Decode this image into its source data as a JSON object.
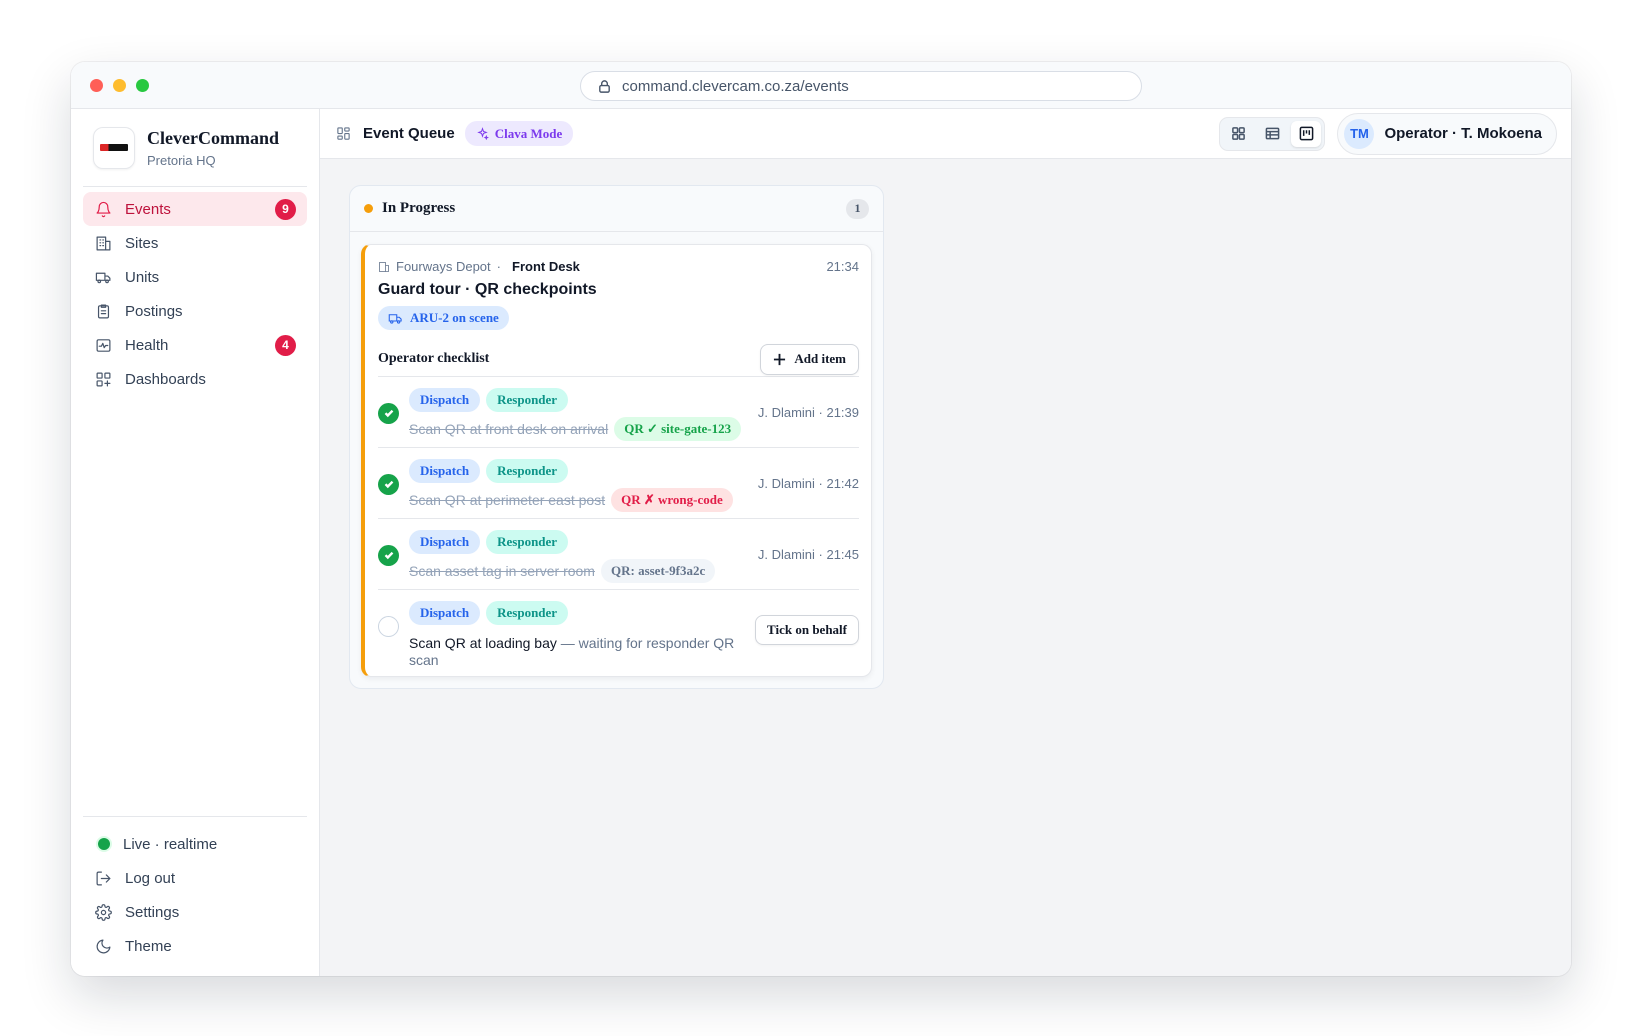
{
  "browser": {
    "url": "command.clevercam.co.za/events"
  },
  "brand": {
    "name": "CleverCommand",
    "location": "Pretoria HQ"
  },
  "nav": {
    "items": [
      {
        "label": "Events",
        "icon": "bell-icon",
        "badge": "9",
        "active": true
      },
      {
        "label": "Sites",
        "icon": "building-icon"
      },
      {
        "label": "Units",
        "icon": "truck-icon"
      },
      {
        "label": "Postings",
        "icon": "clipboard-icon"
      },
      {
        "label": "Health",
        "icon": "activity-icon",
        "badge": "4"
      },
      {
        "label": "Dashboards",
        "icon": "grid-plus-icon"
      }
    ]
  },
  "sidebar_bottom": {
    "live": "Live · realtime",
    "logout": "Log out",
    "settings": "Settings",
    "theme": "Theme"
  },
  "topbar": {
    "title": "Event Queue",
    "mode": "Clava Mode",
    "operator_initials": "TM",
    "operator_name": "Operator · T. Mokoena"
  },
  "column": {
    "title": "In Progress",
    "count": "1",
    "accent": "#f59e0b"
  },
  "card": {
    "site": "Fourways Depot",
    "separator": "·",
    "location": "Front Desk",
    "time": "21:34",
    "title": "Guard tour · QR checkpoints",
    "unit": "ARU-2 on scene",
    "checklist_title": "Operator checklist",
    "add_item": "Add item",
    "items": [
      {
        "tags": [
          "Dispatch",
          "Responder"
        ],
        "text": "Scan QR at front desk on arrival",
        "qr": "QR ✓ site-gate-123",
        "qr_status": "ok",
        "who": "J. Dlamini · 21:39",
        "done": true
      },
      {
        "tags": [
          "Dispatch",
          "Responder"
        ],
        "text": "Scan QR at perimeter east post",
        "qr": "QR ✗ wrong-code",
        "qr_status": "bad",
        "who": "J. Dlamini · 21:42",
        "done": true
      },
      {
        "tags": [
          "Dispatch",
          "Responder"
        ],
        "text": "Scan asset tag in server room",
        "qr": "QR: asset-9f3a2c",
        "qr_status": "neutral",
        "who": "J. Dlamini · 21:45",
        "done": true
      },
      {
        "tags": [
          "Dispatch",
          "Responder"
        ],
        "text": "Scan QR at loading bay",
        "note": " — waiting for responder QR scan",
        "action": "Tick on behalf",
        "done": false
      }
    ]
  }
}
